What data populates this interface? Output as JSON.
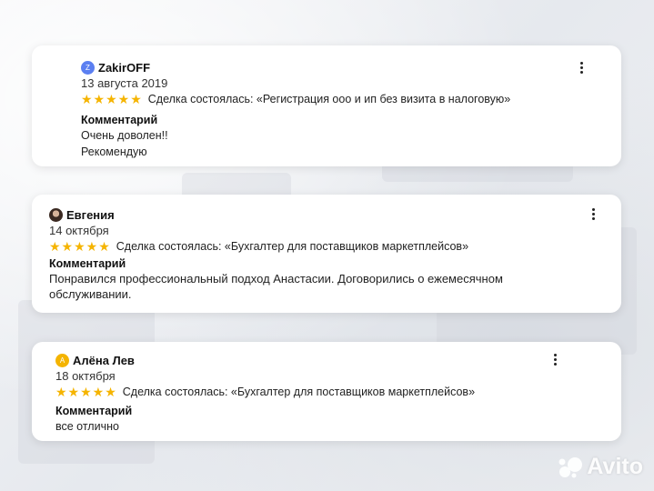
{
  "reviews": [
    {
      "author": "ZakirOFF",
      "avatar_letter": "Z",
      "avatar_color": "#5b7ff1",
      "date": "13 августа 2019",
      "rating": 5,
      "stars": "★★★★★",
      "deal": "Сделка состоялась: «Регистрация ооо и ип без визита в налоговую»",
      "comment_title": "Комментарий",
      "comment_lines": [
        "Очень доволен!!",
        "Рекомендую"
      ]
    },
    {
      "author": "Евгения",
      "avatar_letter": "",
      "date": "14 октября",
      "rating": 5,
      "stars": "★★★★★",
      "deal": "Сделка состоялась: «Бухгалтер для поставщиков маркетплейсов»",
      "comment_title": "Комментарий",
      "comment_text": "Понравился профессиональный подход Анастасии. Договорились о ежемесячном обслуживании."
    },
    {
      "author": "Алёна Лев",
      "avatar_letter": "А",
      "avatar_color": "#f4b400",
      "date": "18 октября",
      "rating": 5,
      "stars": "★★★★★",
      "deal": "Сделка состоялась: «Бухгалтер для поставщиков маркетплейсов»",
      "comment_title": "Комментарий",
      "comment_lines": [
        "все отлично"
      ]
    }
  ],
  "watermark": "Avito",
  "colors": {
    "star": "#f5b400",
    "card": "#ffffff"
  }
}
